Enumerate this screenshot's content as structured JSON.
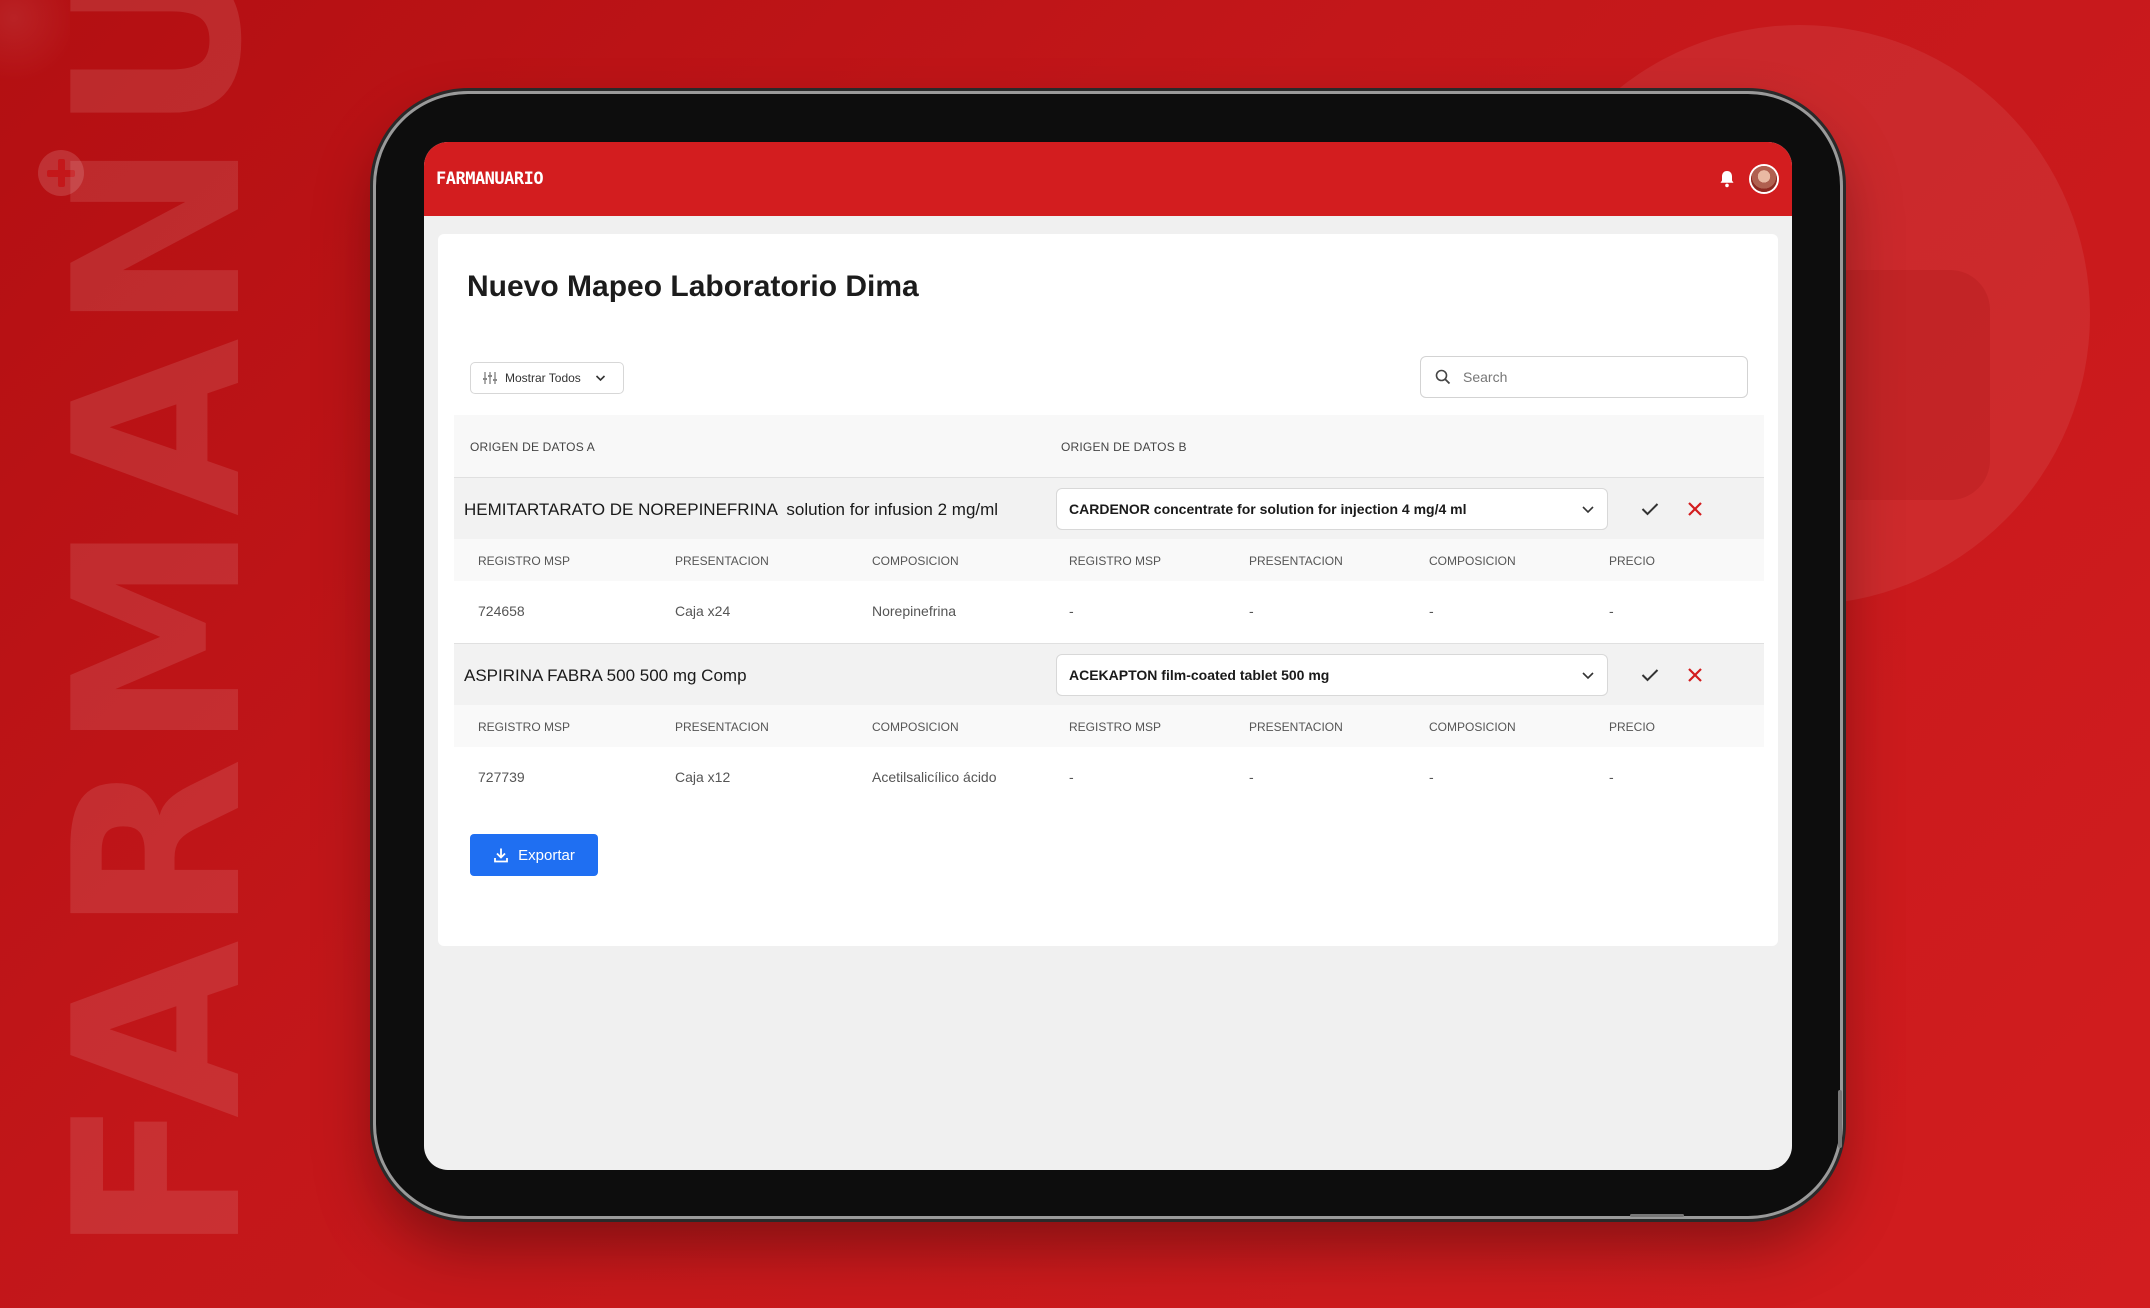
{
  "background": {
    "wordmark": "FARMANUARIO",
    "brand_color": "#d31d1f"
  },
  "app": {
    "logo_text": "FARMANUARIO",
    "accent_color": "#d31d1f",
    "notification_icon": "bell-icon",
    "avatar_icon": "user-avatar"
  },
  "page": {
    "title": "Nuevo Mapeo Laboratorio Dima"
  },
  "toolbar": {
    "filter_label": "Mostrar Todos",
    "filter_icon": "sliders-icon",
    "search_placeholder": "Search",
    "search_value": ""
  },
  "table": {
    "column_a": "ORIGEN DE DATOS A",
    "column_b": "ORIGEN DE DATOS B",
    "sub_headers_a": [
      "REGISTRO MSP",
      "PRESENTACION",
      "COMPOSICION"
    ],
    "sub_headers_b": [
      "REGISTRO MSP",
      "PRESENTACION",
      "COMPOSICION",
      "PRECIO"
    ],
    "rows": [
      {
        "product_a": "HEMITARTARATO DE NOREPINEFRINA  solution for infusion 2 mg/ml",
        "product_b": "CARDENOR concentrate for solution for injection 4 mg/4 ml",
        "a_values": [
          "724658",
          "Caja x24",
          "Norepinefrina"
        ],
        "b_values": [
          "-",
          "-",
          "-",
          "-"
        ]
      },
      {
        "product_a": "ASPIRINA FABRA 500 500 mg Comp",
        "product_b": "ACEKAPTON film-coated tablet 500 mg",
        "a_values": [
          "727739",
          "Caja x12",
          "Acetilsalicílico ácido"
        ],
        "b_values": [
          "-",
          "-",
          "-",
          "-"
        ]
      }
    ]
  },
  "actions": {
    "export_label": "Exportar",
    "confirm_color": "#333333",
    "reject_color": "#d31d1f"
  }
}
